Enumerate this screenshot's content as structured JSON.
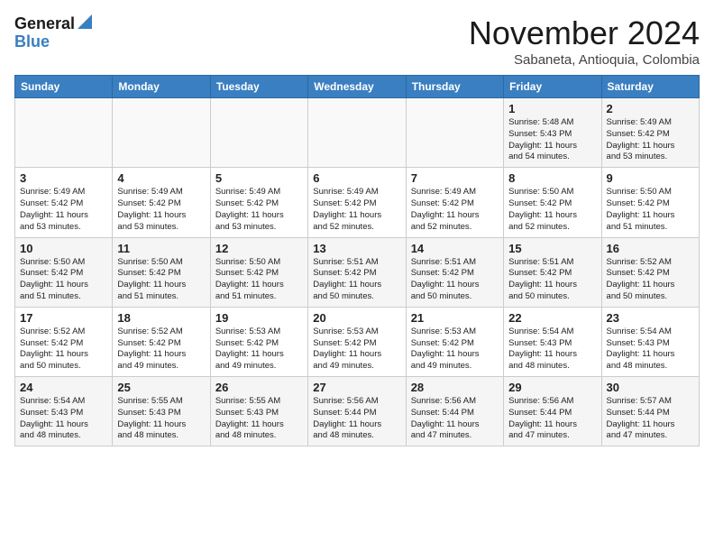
{
  "header": {
    "logo_line1": "General",
    "logo_line2": "Blue",
    "month": "November 2024",
    "location": "Sabaneta, Antioquia, Colombia"
  },
  "days_of_week": [
    "Sunday",
    "Monday",
    "Tuesday",
    "Wednesday",
    "Thursday",
    "Friday",
    "Saturday"
  ],
  "weeks": [
    [
      {
        "day": "",
        "info": ""
      },
      {
        "day": "",
        "info": ""
      },
      {
        "day": "",
        "info": ""
      },
      {
        "day": "",
        "info": ""
      },
      {
        "day": "",
        "info": ""
      },
      {
        "day": "1",
        "info": "Sunrise: 5:48 AM\nSunset: 5:43 PM\nDaylight: 11 hours\nand 54 minutes."
      },
      {
        "day": "2",
        "info": "Sunrise: 5:49 AM\nSunset: 5:42 PM\nDaylight: 11 hours\nand 53 minutes."
      }
    ],
    [
      {
        "day": "3",
        "info": "Sunrise: 5:49 AM\nSunset: 5:42 PM\nDaylight: 11 hours\nand 53 minutes."
      },
      {
        "day": "4",
        "info": "Sunrise: 5:49 AM\nSunset: 5:42 PM\nDaylight: 11 hours\nand 53 minutes."
      },
      {
        "day": "5",
        "info": "Sunrise: 5:49 AM\nSunset: 5:42 PM\nDaylight: 11 hours\nand 53 minutes."
      },
      {
        "day": "6",
        "info": "Sunrise: 5:49 AM\nSunset: 5:42 PM\nDaylight: 11 hours\nand 52 minutes."
      },
      {
        "day": "7",
        "info": "Sunrise: 5:49 AM\nSunset: 5:42 PM\nDaylight: 11 hours\nand 52 minutes."
      },
      {
        "day": "8",
        "info": "Sunrise: 5:50 AM\nSunset: 5:42 PM\nDaylight: 11 hours\nand 52 minutes."
      },
      {
        "day": "9",
        "info": "Sunrise: 5:50 AM\nSunset: 5:42 PM\nDaylight: 11 hours\nand 51 minutes."
      }
    ],
    [
      {
        "day": "10",
        "info": "Sunrise: 5:50 AM\nSunset: 5:42 PM\nDaylight: 11 hours\nand 51 minutes."
      },
      {
        "day": "11",
        "info": "Sunrise: 5:50 AM\nSunset: 5:42 PM\nDaylight: 11 hours\nand 51 minutes."
      },
      {
        "day": "12",
        "info": "Sunrise: 5:50 AM\nSunset: 5:42 PM\nDaylight: 11 hours\nand 51 minutes."
      },
      {
        "day": "13",
        "info": "Sunrise: 5:51 AM\nSunset: 5:42 PM\nDaylight: 11 hours\nand 50 minutes."
      },
      {
        "day": "14",
        "info": "Sunrise: 5:51 AM\nSunset: 5:42 PM\nDaylight: 11 hours\nand 50 minutes."
      },
      {
        "day": "15",
        "info": "Sunrise: 5:51 AM\nSunset: 5:42 PM\nDaylight: 11 hours\nand 50 minutes."
      },
      {
        "day": "16",
        "info": "Sunrise: 5:52 AM\nSunset: 5:42 PM\nDaylight: 11 hours\nand 50 minutes."
      }
    ],
    [
      {
        "day": "17",
        "info": "Sunrise: 5:52 AM\nSunset: 5:42 PM\nDaylight: 11 hours\nand 50 minutes."
      },
      {
        "day": "18",
        "info": "Sunrise: 5:52 AM\nSunset: 5:42 PM\nDaylight: 11 hours\nand 49 minutes."
      },
      {
        "day": "19",
        "info": "Sunrise: 5:53 AM\nSunset: 5:42 PM\nDaylight: 11 hours\nand 49 minutes."
      },
      {
        "day": "20",
        "info": "Sunrise: 5:53 AM\nSunset: 5:42 PM\nDaylight: 11 hours\nand 49 minutes."
      },
      {
        "day": "21",
        "info": "Sunrise: 5:53 AM\nSunset: 5:42 PM\nDaylight: 11 hours\nand 49 minutes."
      },
      {
        "day": "22",
        "info": "Sunrise: 5:54 AM\nSunset: 5:43 PM\nDaylight: 11 hours\nand 48 minutes."
      },
      {
        "day": "23",
        "info": "Sunrise: 5:54 AM\nSunset: 5:43 PM\nDaylight: 11 hours\nand 48 minutes."
      }
    ],
    [
      {
        "day": "24",
        "info": "Sunrise: 5:54 AM\nSunset: 5:43 PM\nDaylight: 11 hours\nand 48 minutes."
      },
      {
        "day": "25",
        "info": "Sunrise: 5:55 AM\nSunset: 5:43 PM\nDaylight: 11 hours\nand 48 minutes."
      },
      {
        "day": "26",
        "info": "Sunrise: 5:55 AM\nSunset: 5:43 PM\nDaylight: 11 hours\nand 48 minutes."
      },
      {
        "day": "27",
        "info": "Sunrise: 5:56 AM\nSunset: 5:44 PM\nDaylight: 11 hours\nand 48 minutes."
      },
      {
        "day": "28",
        "info": "Sunrise: 5:56 AM\nSunset: 5:44 PM\nDaylight: 11 hours\nand 47 minutes."
      },
      {
        "day": "29",
        "info": "Sunrise: 5:56 AM\nSunset: 5:44 PM\nDaylight: 11 hours\nand 47 minutes."
      },
      {
        "day": "30",
        "info": "Sunrise: 5:57 AM\nSunset: 5:44 PM\nDaylight: 11 hours\nand 47 minutes."
      }
    ]
  ]
}
